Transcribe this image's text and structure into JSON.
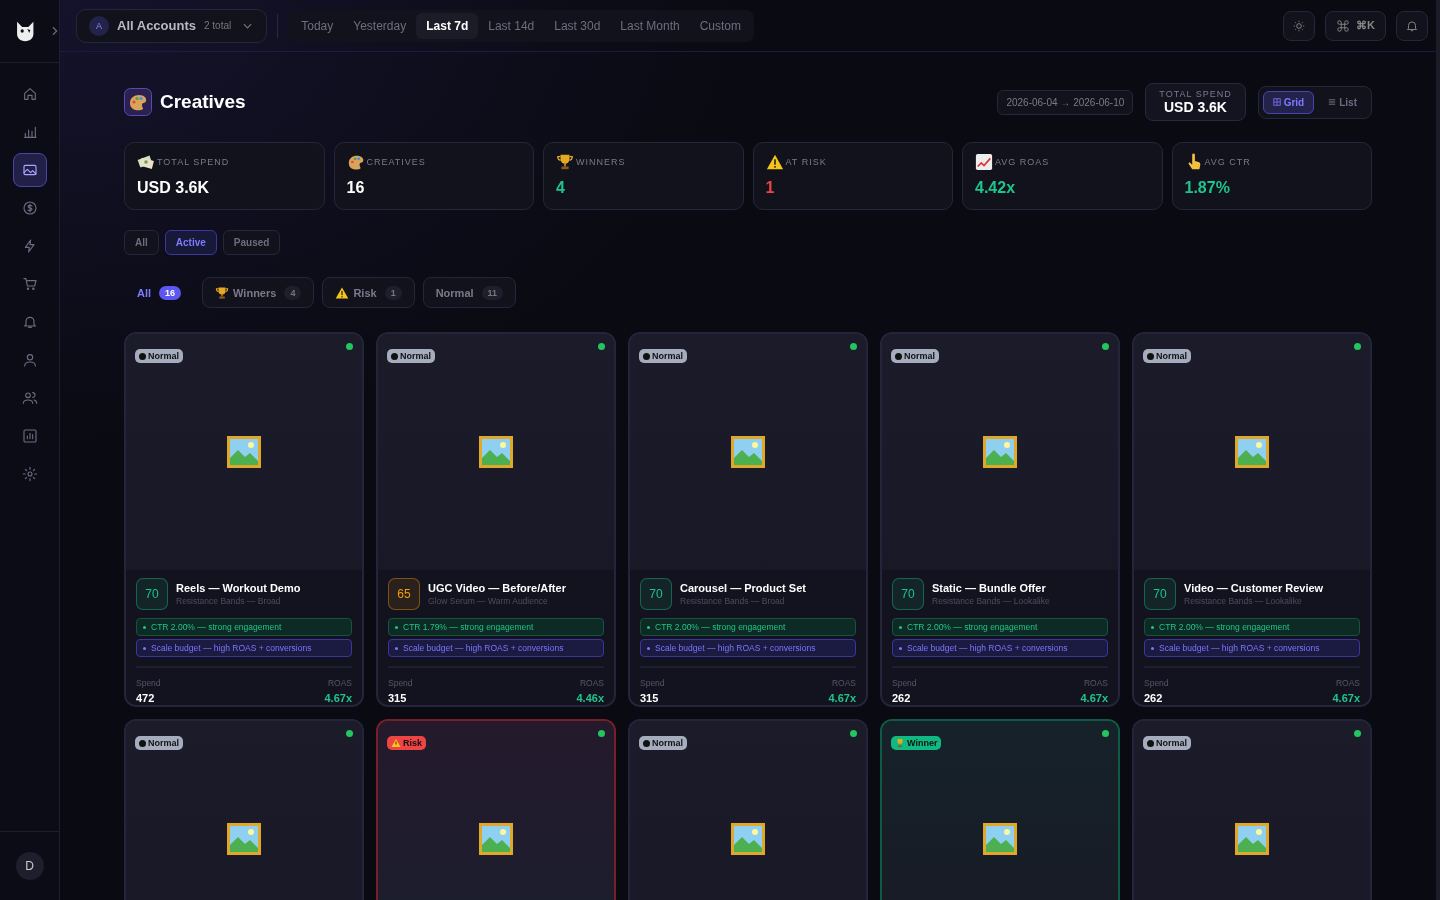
{
  "sidebar": {
    "items": [
      {
        "kind": "home",
        "selected": false
      },
      {
        "kind": "bars",
        "selected": false
      },
      {
        "kind": "image",
        "selected": true
      },
      {
        "kind": "dollar",
        "selected": false
      },
      {
        "kind": "bolt",
        "selected": false
      },
      {
        "kind": "cart",
        "selected": false
      },
      {
        "kind": "bell",
        "selected": false
      },
      {
        "kind": "user",
        "selected": false
      },
      {
        "kind": "users",
        "selected": false
      },
      {
        "kind": "chart",
        "selected": false
      },
      {
        "kind": "gear",
        "selected": false
      }
    ],
    "avatar": "D"
  },
  "topbar": {
    "account": {
      "avatar": "A",
      "name": "All Accounts",
      "count": "2 total"
    },
    "ranges": [
      {
        "label": "Today",
        "selected": false
      },
      {
        "label": "Yesterday",
        "selected": false
      },
      {
        "label": "Last 7d",
        "selected": true
      },
      {
        "label": "Last 14d",
        "selected": false
      },
      {
        "label": "Last 30d",
        "selected": false
      },
      {
        "label": "Last Month",
        "selected": false
      },
      {
        "label": "Custom",
        "selected": false
      }
    ],
    "shortcut": "⌘K"
  },
  "header": {
    "title": "Creatives",
    "date_range": "2026-06-04 → 2026-06-10",
    "total_label": "TOTAL SPEND",
    "total_value": "USD 3.6K",
    "views": [
      {
        "kind": "grid",
        "label": "Grid",
        "selected": true
      },
      {
        "kind": "list",
        "label": "List",
        "selected": false
      }
    ]
  },
  "stats": [
    {
      "kind": "money",
      "label": "TOTAL SPEND",
      "value": "USD 3.6K",
      "color": "#ffffff"
    },
    {
      "kind": "palette",
      "label": "CREATIVES",
      "value": "16",
      "color": "#ffffff"
    },
    {
      "kind": "trophy",
      "label": "WINNERS",
      "value": "4",
      "color": "#1fc48c"
    },
    {
      "kind": "warning",
      "label": "AT RISK",
      "value": "1",
      "color": "#ef4444"
    },
    {
      "kind": "chart",
      "label": "AVG ROAS",
      "value": "4.42x",
      "color": "#1fc48c"
    },
    {
      "kind": "pointer",
      "label": "AVG CTR",
      "value": "1.87%",
      "color": "#1fc48c"
    }
  ],
  "status_filter": [
    {
      "label": "All",
      "selected": false
    },
    {
      "label": "Active",
      "selected": true
    },
    {
      "label": "Paused",
      "selected": false
    }
  ],
  "segments": [
    {
      "kind": "plain",
      "label": "All",
      "count": "16",
      "selected": true
    },
    {
      "kind": "trophy",
      "label": "Winners",
      "count": "4",
      "selected": false
    },
    {
      "kind": "warning",
      "label": "Risk",
      "count": "1",
      "selected": false
    },
    {
      "kind": "plain",
      "label": "Normal",
      "count": "11",
      "selected": false
    }
  ],
  "cards": [
    {
      "badge": {
        "kind": "normal",
        "label": "Normal"
      },
      "live": true,
      "score": {
        "text": "70",
        "color": "#1fc48c"
      },
      "title": "Reels — Workout Demo",
      "subtitle": "Resistance Bands — Broad",
      "signals": [
        {
          "kind": "ctr",
          "text": "CTR 2.00% — strong engagement"
        },
        {
          "kind": "action",
          "text": "Scale budget — high ROAS + conversions"
        }
      ],
      "spend_label": "Spend",
      "spend": "472",
      "roas_label": "ROAS",
      "roas": "4.67x"
    },
    {
      "badge": {
        "kind": "normal",
        "label": "Normal"
      },
      "live": true,
      "score": {
        "text": "65",
        "color": "#f59e0b"
      },
      "title": "UGC Video — Before/After",
      "subtitle": "Glow Serum — Warm Audience",
      "signals": [
        {
          "kind": "ctr",
          "text": "CTR 1.79% — strong engagement"
        },
        {
          "kind": "action",
          "text": "Scale budget — high ROAS + conversions"
        }
      ],
      "spend_label": "Spend",
      "spend": "315",
      "roas_label": "ROAS",
      "roas": "4.46x"
    },
    {
      "badge": {
        "kind": "normal",
        "label": "Normal"
      },
      "live": true,
      "score": {
        "text": "70",
        "color": "#1fc48c"
      },
      "title": "Carousel — Product Set",
      "subtitle": "Resistance Bands — Broad",
      "signals": [
        {
          "kind": "ctr",
          "text": "CTR 2.00% — strong engagement"
        },
        {
          "kind": "action",
          "text": "Scale budget — high ROAS + conversions"
        }
      ],
      "spend_label": "Spend",
      "spend": "315",
      "roas_label": "ROAS",
      "roas": "4.67x"
    },
    {
      "badge": {
        "kind": "normal",
        "label": "Normal"
      },
      "live": true,
      "score": {
        "text": "70",
        "color": "#1fc48c"
      },
      "title": "Static — Bundle Offer",
      "subtitle": "Resistance Bands — Lookalike",
      "signals": [
        {
          "kind": "ctr",
          "text": "CTR 2.00% — strong engagement"
        },
        {
          "kind": "action",
          "text": "Scale budget — high ROAS + conversions"
        }
      ],
      "spend_label": "Spend",
      "spend": "262",
      "roas_label": "ROAS",
      "roas": "4.67x"
    },
    {
      "badge": {
        "kind": "normal",
        "label": "Normal"
      },
      "live": true,
      "score": {
        "text": "70",
        "color": "#1fc48c"
      },
      "title": "Video — Customer Review",
      "subtitle": "Resistance Bands — Lookalike",
      "signals": [
        {
          "kind": "ctr",
          "text": "CTR 2.00% — strong engagement"
        },
        {
          "kind": "action",
          "text": "Scale budget — high ROAS + conversions"
        }
      ],
      "spend_label": "Spend",
      "spend": "262",
      "roas_label": "ROAS",
      "roas": "4.67x"
    },
    {
      "badge": {
        "kind": "normal",
        "label": "Normal"
      },
      "live": true
    },
    {
      "badge": {
        "kind": "risk",
        "label": "Risk"
      },
      "live": true
    },
    {
      "badge": {
        "kind": "normal",
        "label": "Normal"
      },
      "live": true
    },
    {
      "badge": {
        "kind": "winner",
        "label": "Winner"
      },
      "live": true
    },
    {
      "badge": {
        "kind": "normal",
        "label": "Normal"
      },
      "live": true
    }
  ]
}
